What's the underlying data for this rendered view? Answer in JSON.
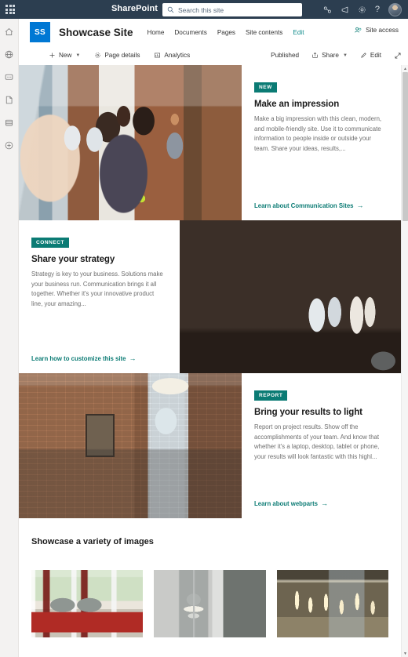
{
  "suite": {
    "waffle_label": "app-launcher",
    "brand": "SharePoint",
    "search_placeholder": "Search this site",
    "icons": [
      "mesh-icon",
      "megaphone-icon",
      "gear-icon",
      "help-icon"
    ],
    "help_glyph": "?",
    "avatar_label": "user-avatar"
  },
  "rail": {
    "items": [
      {
        "name": "home-icon",
        "label": "Home"
      },
      {
        "name": "globe-icon",
        "label": "Feed"
      },
      {
        "name": "chat-icon",
        "label": "Conversations"
      },
      {
        "name": "page-icon",
        "label": "Pages"
      },
      {
        "name": "library-icon",
        "label": "Content"
      },
      {
        "name": "create-icon",
        "label": "Create"
      }
    ]
  },
  "site": {
    "logo_initials": "SS",
    "title": "Showcase Site",
    "nav": [
      {
        "label": "Home",
        "active": false
      },
      {
        "label": "Documents",
        "active": false
      },
      {
        "label": "Pages",
        "active": false
      },
      {
        "label": "Site contents",
        "active": false
      },
      {
        "label": "Edit",
        "active": true
      }
    ],
    "site_access_label": "Site access"
  },
  "commandbar": {
    "new_label": "New",
    "page_details_label": "Page details",
    "analytics_label": "Analytics",
    "published_label": "Published",
    "share_label": "Share",
    "edit_label": "Edit",
    "expand_label": "Full screen"
  },
  "hero": {
    "tiles": [
      {
        "badge": "NEW",
        "title": "Make an impression",
        "description": "Make a big impression with this clean, modern, and mobile-friendly site. Use it to communicate information to people inside or outside your team. Share your ideas, results,...",
        "link": "Learn about Communication Sites",
        "arrow": "→",
        "image_alt": "team-meeting-photo",
        "layout": "image-left"
      },
      {
        "badge": "CONNECT",
        "title": "Share your strategy",
        "description": "Strategy is key to your business. Solutions make your business run. Communication brings it all together. Whether it's your innovative product line, your amazing...",
        "link": "Learn how to customize this site",
        "arrow": "→",
        "image_alt": "glass-walled-office-photo",
        "layout": "image-right"
      },
      {
        "badge": "REPORT",
        "title": "Bring your results to light",
        "description": "Report on project results. Show off the accomplishments of your team. And know that whether it's a laptop, desktop, tablet or phone, your results will look fantastic with this highl...",
        "link": "Learn about webparts",
        "arrow": "→",
        "image_alt": "brick-wall-entry-photo",
        "layout": "image-left"
      }
    ]
  },
  "gallery": {
    "title": "Showcase a variety of images",
    "images": [
      {
        "alt": "red-armchairs-by-window"
      },
      {
        "alt": "pendant-lamp"
      },
      {
        "alt": "lit-office-interior"
      }
    ]
  },
  "scrollbar": {
    "up_glyph": "▲",
    "down_glyph": "▼"
  },
  "colors": {
    "suite_bar": "#2c3e50",
    "site_logo": "#0078d4",
    "accent_teal": "#0b7b74",
    "link_teal": "#0e8a8a"
  }
}
